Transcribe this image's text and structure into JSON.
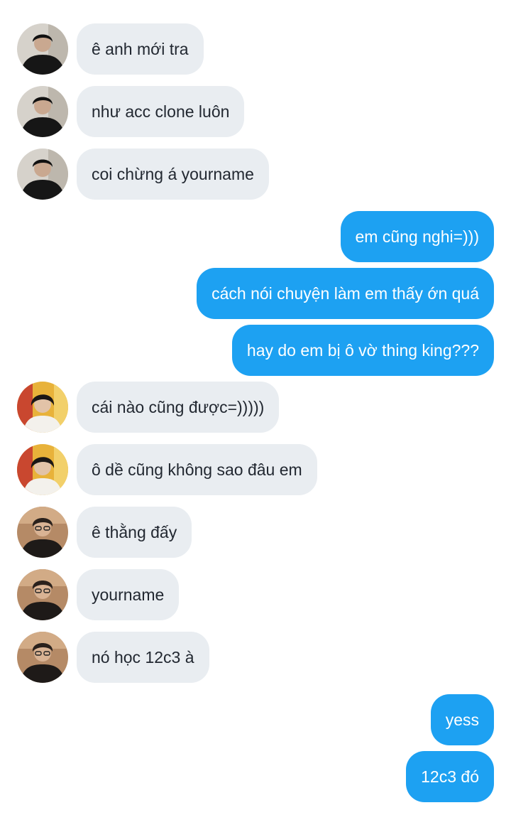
{
  "colors": {
    "incoming_bubble": "#e9edf1",
    "outgoing_bubble": "#1da1f2",
    "incoming_text": "#222831",
    "outgoing_text": "#ffffff"
  },
  "messages": [
    {
      "direction": "incoming",
      "sender_avatar": "avatar-dark-jacket",
      "text": "ê anh mới tra"
    },
    {
      "direction": "incoming",
      "sender_avatar": "avatar-dark-jacket",
      "text": "như acc clone luôn"
    },
    {
      "direction": "incoming",
      "sender_avatar": "avatar-dark-jacket",
      "text": "coi chừng á yourname"
    },
    {
      "direction": "outgoing",
      "text": "em cũng nghi=)))"
    },
    {
      "direction": "outgoing",
      "text": "cách nói chuyện làm em thấy ớn quá"
    },
    {
      "direction": "outgoing",
      "text": "hay do em bị ô vờ thing king???"
    },
    {
      "direction": "incoming",
      "sender_avatar": "avatar-colorful-background",
      "text": "cái nào cũng được=)))))"
    },
    {
      "direction": "incoming",
      "sender_avatar": "avatar-colorful-background",
      "text": "ô dề cũng không sao đâu em"
    },
    {
      "direction": "incoming",
      "sender_avatar": "avatar-glasses",
      "text": "ê thằng đấy"
    },
    {
      "direction": "incoming",
      "sender_avatar": "avatar-glasses",
      "text": "yourname"
    },
    {
      "direction": "incoming",
      "sender_avatar": "avatar-glasses",
      "text": "nó học 12c3 à"
    },
    {
      "direction": "outgoing",
      "text": "yess"
    },
    {
      "direction": "outgoing",
      "text": "12c3 đó"
    }
  ]
}
